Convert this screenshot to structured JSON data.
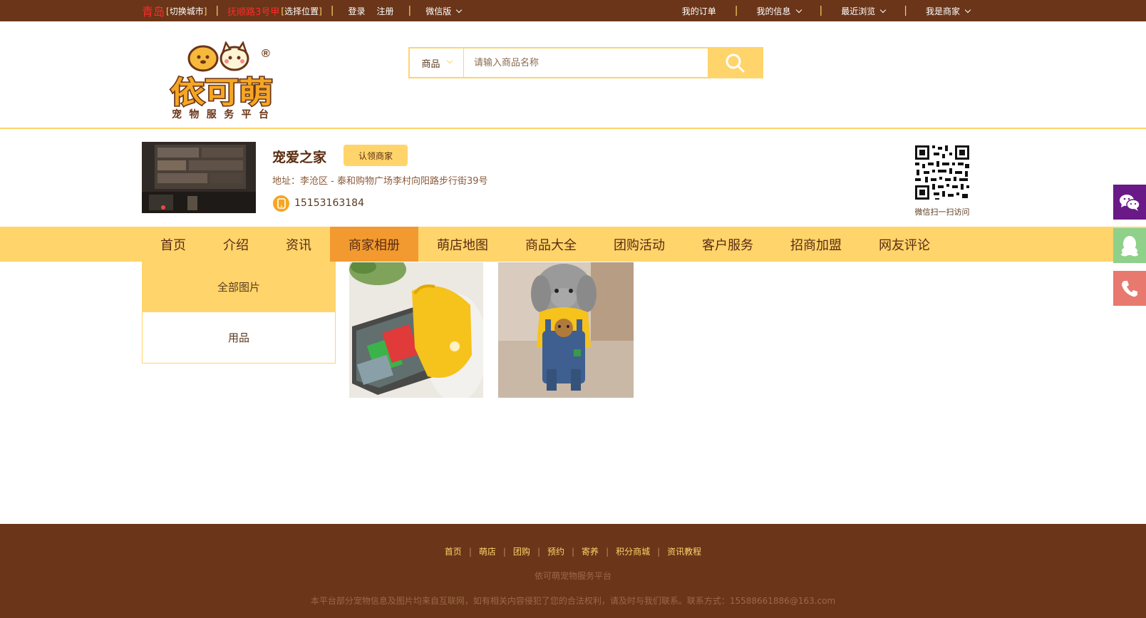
{
  "topbar": {
    "city": "青岛",
    "switch_city": "切换城市",
    "location": "抚顺路3号甲",
    "select_location": "选择位置",
    "login": "登录",
    "register": "注册",
    "wechat_version": "微信版",
    "my_orders": "我的订单",
    "my_info": "我的信息",
    "recent_browse": "最近浏览",
    "i_am_merchant": "我是商家"
  },
  "header": {
    "logo_text": "依可萌",
    "logo_subtitle": "宠物服务平台",
    "search_category": "商品",
    "search_placeholder": "请输入商品名称"
  },
  "shop": {
    "name": "宠爱之家",
    "claim_button": "认领商家",
    "address": "地址：李沧区 - 泰和购物广场李村向阳路步行街39号",
    "phone": "15153163184",
    "qr_caption": "微信扫一扫访问"
  },
  "nav": {
    "items": [
      "首页",
      "介绍",
      "资讯",
      "商家相册",
      "萌店地图",
      "商品大全",
      "团购活动",
      "客户服务",
      "招商加盟",
      "网友评论"
    ],
    "active_index": 3
  },
  "album": {
    "categories": [
      "全部图片",
      "用品"
    ],
    "active_index": 0
  },
  "footer": {
    "links": [
      "首页",
      "萌店",
      "团购",
      "预约",
      "寄养",
      "积分商城",
      "资讯教程"
    ],
    "site_name": "依可萌宠物服务平台",
    "notice": "本平台部分宠物信息及图片均来自互联网，如有相关内容侵犯了您的合法权利，请及时与我们联系。联系方式：15588661886@163.com"
  },
  "colors": {
    "brown": "#6a3518",
    "gold": "#ffd46b",
    "orange_active": "#f29a30",
    "wechat": "#6a1a86",
    "qq": "#8fd08a",
    "phone": "#e8796f"
  }
}
